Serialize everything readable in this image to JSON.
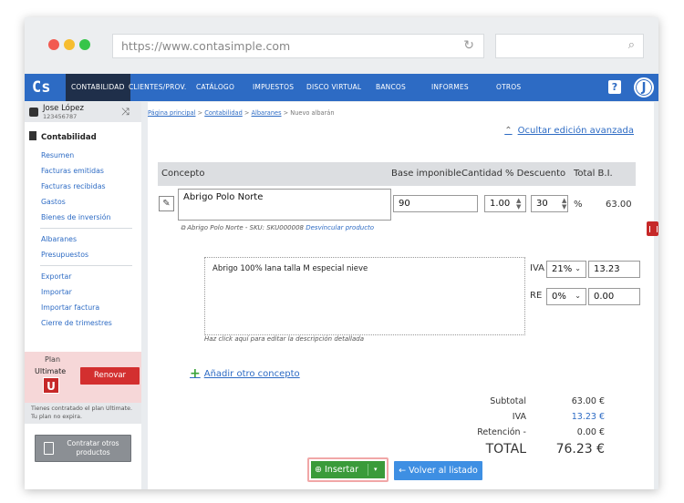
{
  "browser": {
    "url": "https://www.contasimple.com"
  },
  "nav": {
    "logo": "Cs",
    "items": [
      "CONTABILIDAD",
      "CLIENTES/PROV.",
      "CATÁLOGO",
      "IMPUESTOS",
      "DISCO VIRTUAL",
      "BANCOS",
      "INFORMES",
      "OTROS"
    ],
    "help": "?",
    "avatar": "J"
  },
  "user": {
    "name": "Jose López",
    "id": "123456787"
  },
  "sidebar": {
    "section": "Contabilidad",
    "group1": [
      "Resumen",
      "Facturas emitidas",
      "Facturas recibidas",
      "Gastos",
      "Bienes de inversión"
    ],
    "group2": [
      "Albaranes",
      "Presupuestos"
    ],
    "group3": [
      "Exportar",
      "Importar",
      "Importar factura",
      "Cierre de trimestres"
    ]
  },
  "plan": {
    "label": "Plan",
    "name": "Ultimate",
    "badge": "U",
    "renew": "Renovar",
    "info": "Tienes contratado el plan Ultimate. Tu plan no expira.",
    "contract": "Contratar otros productos"
  },
  "breadcrumb": {
    "home": "Página principal",
    "c1": "Contabilidad",
    "c2": "Albaranes",
    "current": "Nuevo albarán",
    "sep": ">"
  },
  "advanced": {
    "link": "Ocultar edición avanzada"
  },
  "table": {
    "headers": {
      "concepto": "Concepto",
      "base": "Base imponible",
      "cantidad": "Cantidad",
      "descuento": "% Descuento",
      "total": "Total B.I."
    },
    "row": {
      "concepto": "Abrigo Polo Norte",
      "base": "90",
      "cantidad": "1.00",
      "descuento": "30",
      "pct": "%",
      "total": "63.00",
      "sku": "Abrigo Polo Norte - SKU: SKU000008",
      "unlink": "Desvincular producto",
      "description": "Abrigo 100% lana talla M especial nieve",
      "hint": "Haz click aquí para editar la descripción detallada",
      "iva_label": "IVA",
      "iva_rate": "21%",
      "iva_value": "13.23",
      "re_label": "RE",
      "re_rate": "0%",
      "re_value": "0.00"
    }
  },
  "add_concept": "Añadir otro concepto",
  "summary": {
    "subtotal_label": "Subtotal",
    "subtotal": "63.00 €",
    "iva_label": "IVA",
    "iva": "13.23 €",
    "ret_label": "Retención -",
    "ret": "0.00 €",
    "total_label": "TOTAL",
    "total": "76.23 €"
  },
  "buttons": {
    "insert": "Insertar",
    "back": "Volver al listado"
  },
  "colors": {
    "nav": "#2d6bc4",
    "insert": "#3a9b3a",
    "back": "#3e8fe3",
    "danger": "#d32f2f"
  }
}
